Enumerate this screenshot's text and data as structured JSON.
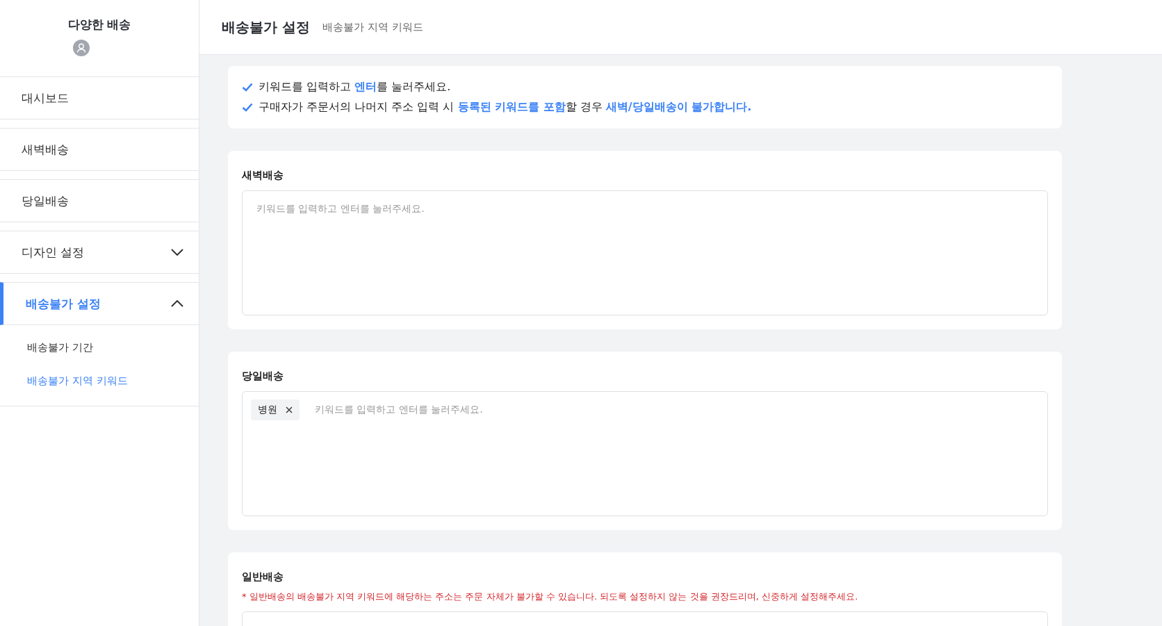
{
  "sidebar": {
    "brand": "다양한 배송",
    "items": [
      {
        "label": "대시보드",
        "kind": "link",
        "selected": false
      },
      {
        "label": "새벽배송",
        "kind": "link",
        "selected": false
      },
      {
        "label": "당일배송",
        "kind": "link",
        "selected": false
      },
      {
        "label": "디자인 설정",
        "kind": "group",
        "selected": false,
        "expanded": false
      },
      {
        "label": "배송불가 설정",
        "kind": "group",
        "selected": true,
        "expanded": true,
        "children": [
          {
            "label": "배송불가 기간",
            "selected": false
          },
          {
            "label": "배송불가 지역 키워드",
            "selected": true
          }
        ]
      }
    ]
  },
  "header": {
    "title": "배송불가 설정",
    "subtitle": "배송불가 지역 키워드"
  },
  "notice": [
    "키워드를 입력하고 **엔터**를 눌러주세요.",
    "구매자가 주문서의 나머지 주소 입력 시 **등록된 키워드를 포함**할 경우 **새벽/당일배송이 불가합니다.**"
  ],
  "sections": [
    {
      "title": "새벽배송",
      "placeholder": "키워드를 입력하고 엔터를 눌러주세요."
    },
    {
      "title": "당일배송",
      "tags": [
        {
          "label": "병원"
        }
      ],
      "placeholder": "키워드를 입력하고 엔터를 눌러주세요."
    },
    {
      "title": "일반배송",
      "warning": "* 일반배송의 배송불가 지역 키워드에 해당하는 주소는 주문 자체가 불가할 수 있습니다. 되도록 설정하지 않는 것을 권장드리며, 신중하게 설정해주세요."
    }
  ]
}
